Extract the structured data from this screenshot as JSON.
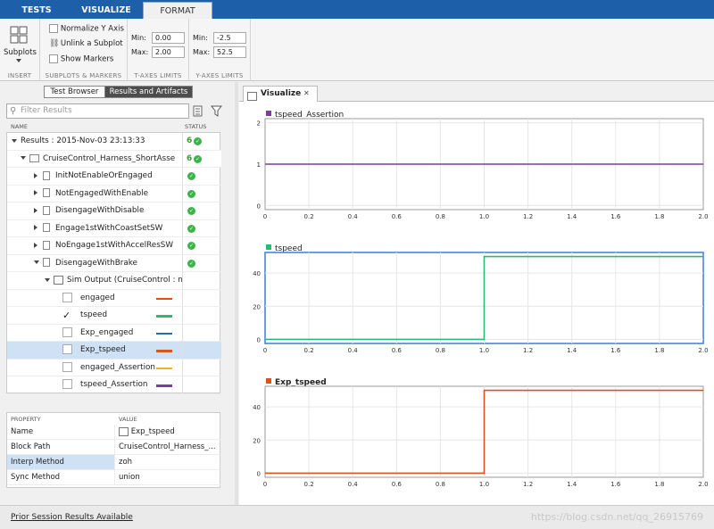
{
  "tabs": [
    {
      "label": "TESTS",
      "active": false
    },
    {
      "label": "VISUALIZE",
      "active": false
    },
    {
      "label": "FORMAT",
      "active": true
    }
  ],
  "toolstrip": {
    "subplots_label": "Subplots",
    "normalize_y_axis": "Normalize Y Axis",
    "unlink_subplot": "Unlink a Subplot",
    "show_markers": "Show Markers",
    "t_min_label": "Min:",
    "t_min_value": "0.00",
    "t_max_label": "Max:",
    "t_max_value": "2.00",
    "y_min_label": "Min:",
    "y_min_value": "-2.5",
    "y_max_label": "Max:",
    "y_max_value": "52.5",
    "sections": [
      "INSERT",
      "SUBPLOTS & MARKERS",
      "T-AXES LIMITS",
      "Y-AXES LIMITS"
    ]
  },
  "left": {
    "seg_test_browser": "Test Browser",
    "seg_results": "Results and Artifacts",
    "filter_placeholder": "Filter Results",
    "col_name": "NAME",
    "col_status": "STATUS",
    "tree": [
      {
        "label": "Results : 2015-Nov-03 23:13:33",
        "count": "6",
        "status": "ok"
      },
      {
        "label": "CruiseControl_Harness_ShortAsse",
        "count": "6",
        "status": "ok"
      },
      {
        "label": "InitNotEnableOrEngaged",
        "status": "ok"
      },
      {
        "label": "NotEngagedWithEnable",
        "status": "ok"
      },
      {
        "label": "DisengageWithDisable",
        "status": "ok"
      },
      {
        "label": "Engage1stWithCoastSetSW",
        "status": "ok"
      },
      {
        "label": "NoEngage1stWithAccelResSW",
        "status": "ok"
      },
      {
        "label": "DisengageWithBrake",
        "status": "ok"
      },
      {
        "label": "Sim Output (CruiseControl : n"
      }
    ],
    "signals": [
      {
        "label": "engaged",
        "checked": false,
        "color": "#e8491d"
      },
      {
        "label": "tspeed",
        "checked": true,
        "color": "#2eb872"
      },
      {
        "label": "Exp_engaged",
        "checked": false,
        "color": "#1f6eb8"
      },
      {
        "label": "Exp_tspeed",
        "checked": false,
        "color": "#d9541e"
      },
      {
        "label": "engaged_Assertion",
        "checked": false,
        "color": "#f0b020"
      },
      {
        "label": "tspeed_Assertion",
        "checked": false,
        "color": "#7d3d9c"
      }
    ],
    "prop_header_property": "PROPERTY",
    "prop_header_value": "VALUE",
    "properties": [
      {
        "key": "Name",
        "value": "Exp_tspeed"
      },
      {
        "key": "Block Path",
        "value": "CruiseControl_Harness_..."
      },
      {
        "key": "Interp Method",
        "value": "zoh"
      },
      {
        "key": "Sync Method",
        "value": "union"
      }
    ]
  },
  "bottom": {
    "link": "Prior Session Results Available",
    "watermark": "https://blog.csdn.net/qq_26915769"
  },
  "visualize": {
    "tab_label": "Visualize",
    "close_glyph": "✕"
  },
  "chart_data": [
    {
      "type": "line",
      "title": "tspeed_Assertion",
      "color": "#7d3d9c",
      "x": [
        0.0,
        2.0
      ],
      "y": [
        1,
        1
      ],
      "xlim": [
        0,
        2
      ],
      "ylim": [
        -0.1,
        2.1
      ],
      "yticks": [
        0,
        1,
        2
      ],
      "xticks": [
        0,
        0.2,
        0.4,
        0.6,
        0.8,
        1.0,
        1.2,
        1.4,
        1.6,
        1.8,
        2.0
      ],
      "grid": true
    },
    {
      "type": "line",
      "title": "tspeed",
      "color": "#2eb872",
      "x": [
        0.0,
        1.0,
        1.0,
        2.0
      ],
      "y": [
        0,
        0,
        50,
        50
      ],
      "xlim": [
        0,
        2
      ],
      "ylim": [
        -2.5,
        52.5
      ],
      "yticks": [
        0,
        20,
        40
      ],
      "xticks": [
        0,
        0.2,
        0.4,
        0.6,
        0.8,
        1.0,
        1.2,
        1.4,
        1.6,
        1.8,
        2.0
      ],
      "grid": true,
      "selected": true
    },
    {
      "type": "line",
      "title": "Exp_tspeed",
      "color": "#d9541e",
      "x": [
        0.0,
        1.0,
        1.0,
        2.0
      ],
      "y": [
        0,
        0,
        50,
        50
      ],
      "xlim": [
        0,
        2
      ],
      "ylim": [
        -2.5,
        52.5
      ],
      "yticks": [
        0,
        20,
        40
      ],
      "xticks": [
        0,
        0.2,
        0.4,
        0.6,
        0.8,
        1.0,
        1.2,
        1.4,
        1.6,
        1.8,
        2.0
      ],
      "grid": true
    }
  ]
}
